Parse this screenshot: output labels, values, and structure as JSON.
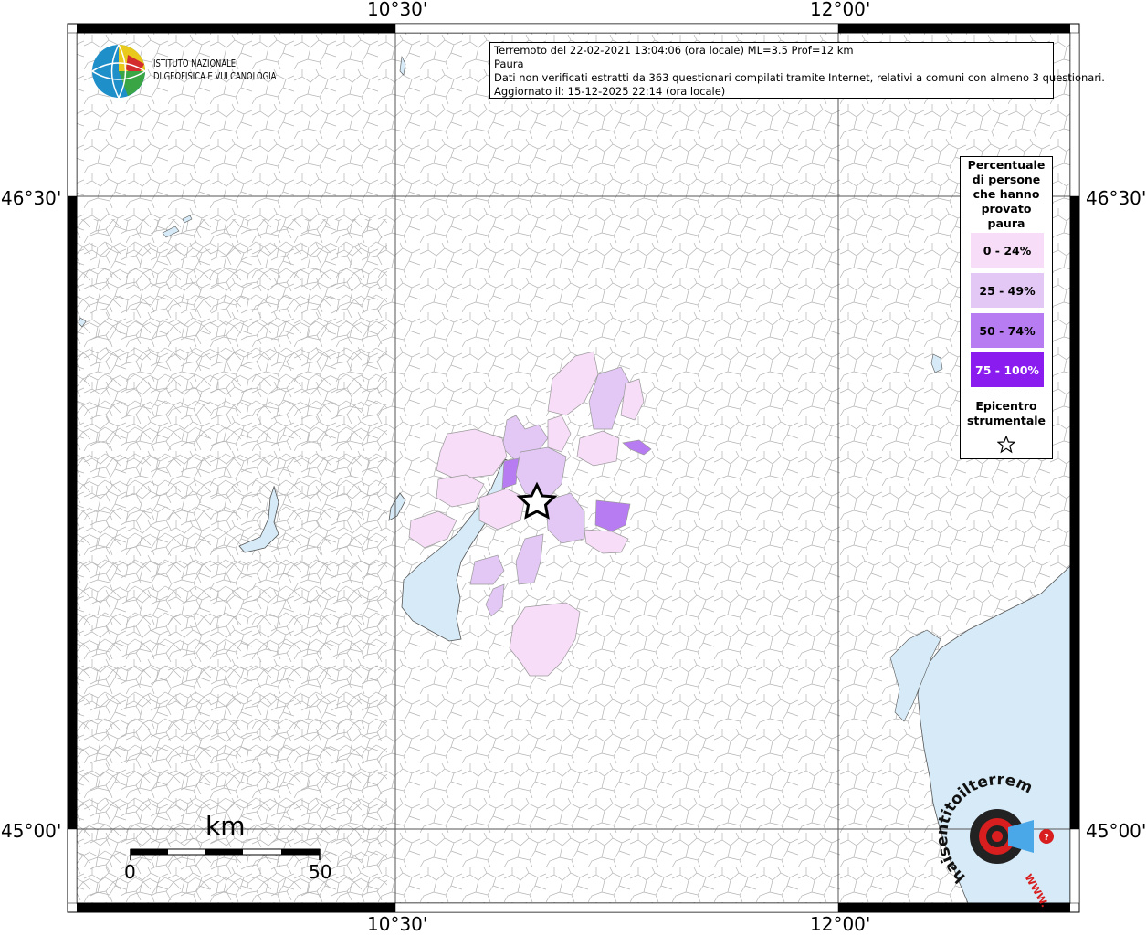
{
  "map": {
    "coord_labels": {
      "top_left": "10°30'",
      "top_right": "12°00'",
      "bottom_left": "10°30'",
      "bottom_right": "12°00'",
      "left_upper": "46°30'",
      "left_lower": "45°00'",
      "right_upper": "46°30'",
      "right_lower": "45°00'"
    }
  },
  "info": {
    "line1": "Terremoto del 22-02-2021 13:04:06 (ora locale) ML=3.5 Prof=12 km",
    "line2": "Paura",
    "line3": "Dati non verificati estratti da 363 questionari compilati tramite Internet, relativi a comuni con almeno 3 questionari.",
    "line4": "Aggiornato il: 15-12-2025 22:14 (ora locale)"
  },
  "logo": {
    "line1": "ISTITUTO NAZIONALE",
    "line2": "DI GEOFISICA E VULCANOLOGIA",
    "site_text": "haisentitoilterremoto.it",
    "site_www": "WWW."
  },
  "legend": {
    "title": "Percentuale di persone che hanno provato paura",
    "items": [
      {
        "label": "0 - 24%",
        "color": "#f7ddf7",
        "text_color": "#000000"
      },
      {
        "label": "25 - 49%",
        "color": "#e3c8f5",
        "text_color": "#000000"
      },
      {
        "label": "50 - 74%",
        "color": "#b87cf2",
        "text_color": "#000000"
      },
      {
        "label": "75 - 100%",
        "color": "#8a1cf0",
        "text_color": "#ffffff"
      }
    ],
    "epicenter_label": "Epicentro strumentale",
    "epicenter_icon": "star-icon"
  },
  "scalebar": {
    "unit": "km",
    "start": "0",
    "end": "50"
  },
  "colors": {
    "water": "#d6ebf7",
    "border_lines": "#b3b3b3",
    "frame": "#000000"
  }
}
